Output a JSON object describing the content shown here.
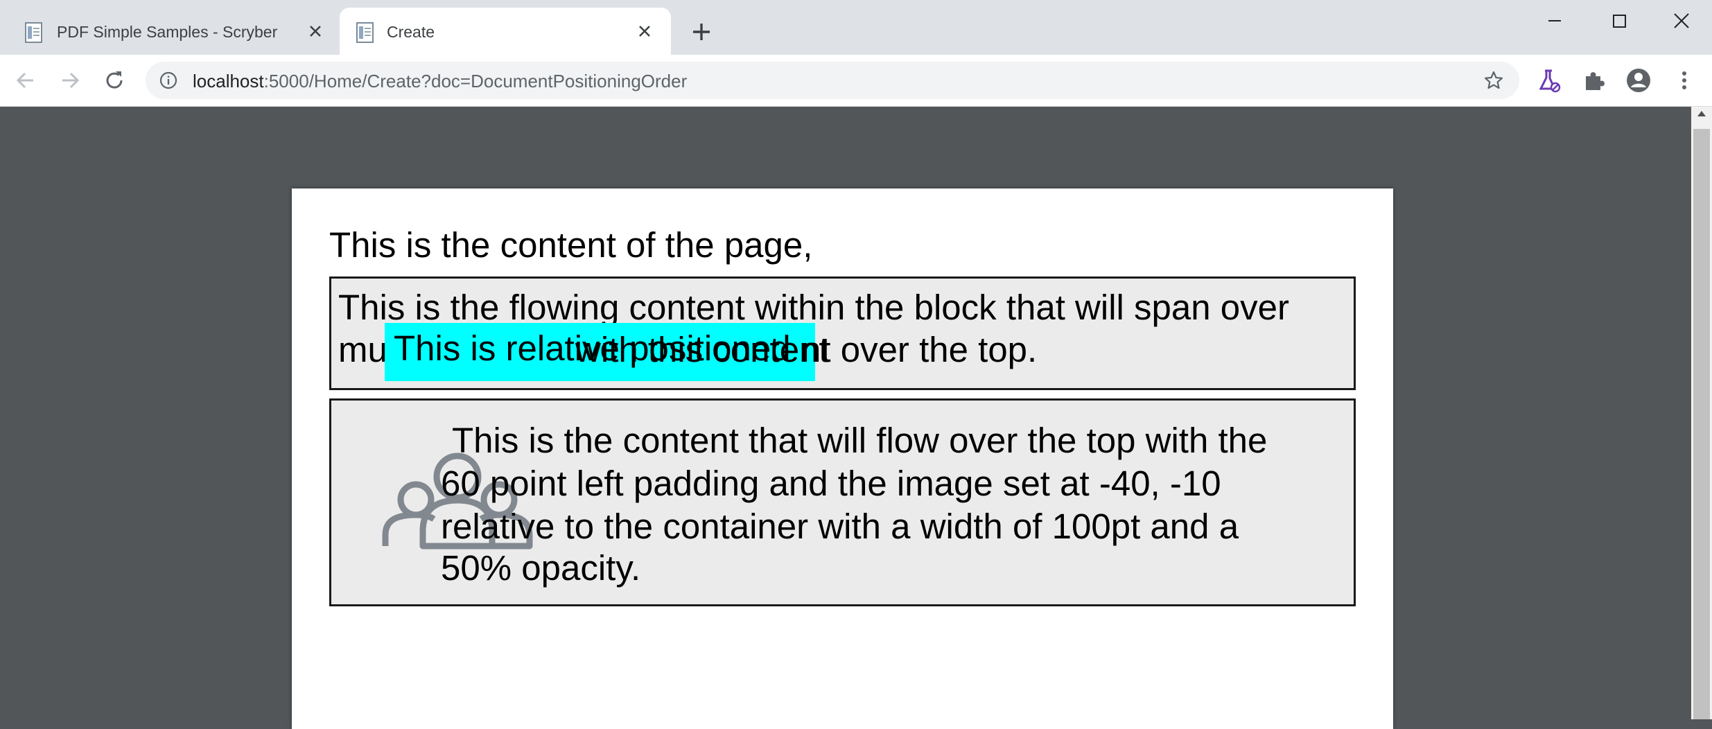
{
  "tabs": [
    {
      "title": "PDF Simple Samples - Scryber",
      "active": false
    },
    {
      "title": "Create",
      "active": true
    }
  ],
  "address_bar": {
    "host": "localhost",
    "path": ":5000/Home/Create?doc=DocumentPositioningOrder"
  },
  "document": {
    "heading": "This is the content of the page,",
    "block1": {
      "line1": "This is the flowing content within the block that will span over",
      "line2_start": "mu",
      "line2_overlap": "with this content",
      "line2_end": "nt over the top.",
      "relative_text": "This is relative positioned"
    },
    "block2": {
      "lines": [
        "This is the content that will flow over the top with the",
        "60 point left padding and the image set at -40, -10",
        "relative to the container with a width of 100pt and a",
        "50% opacity."
      ],
      "image_icon": "people-group-icon"
    }
  },
  "colors": {
    "relative_highlight": "#00ffff",
    "viewer_background": "#525659",
    "block_background": "#ebebeb"
  }
}
